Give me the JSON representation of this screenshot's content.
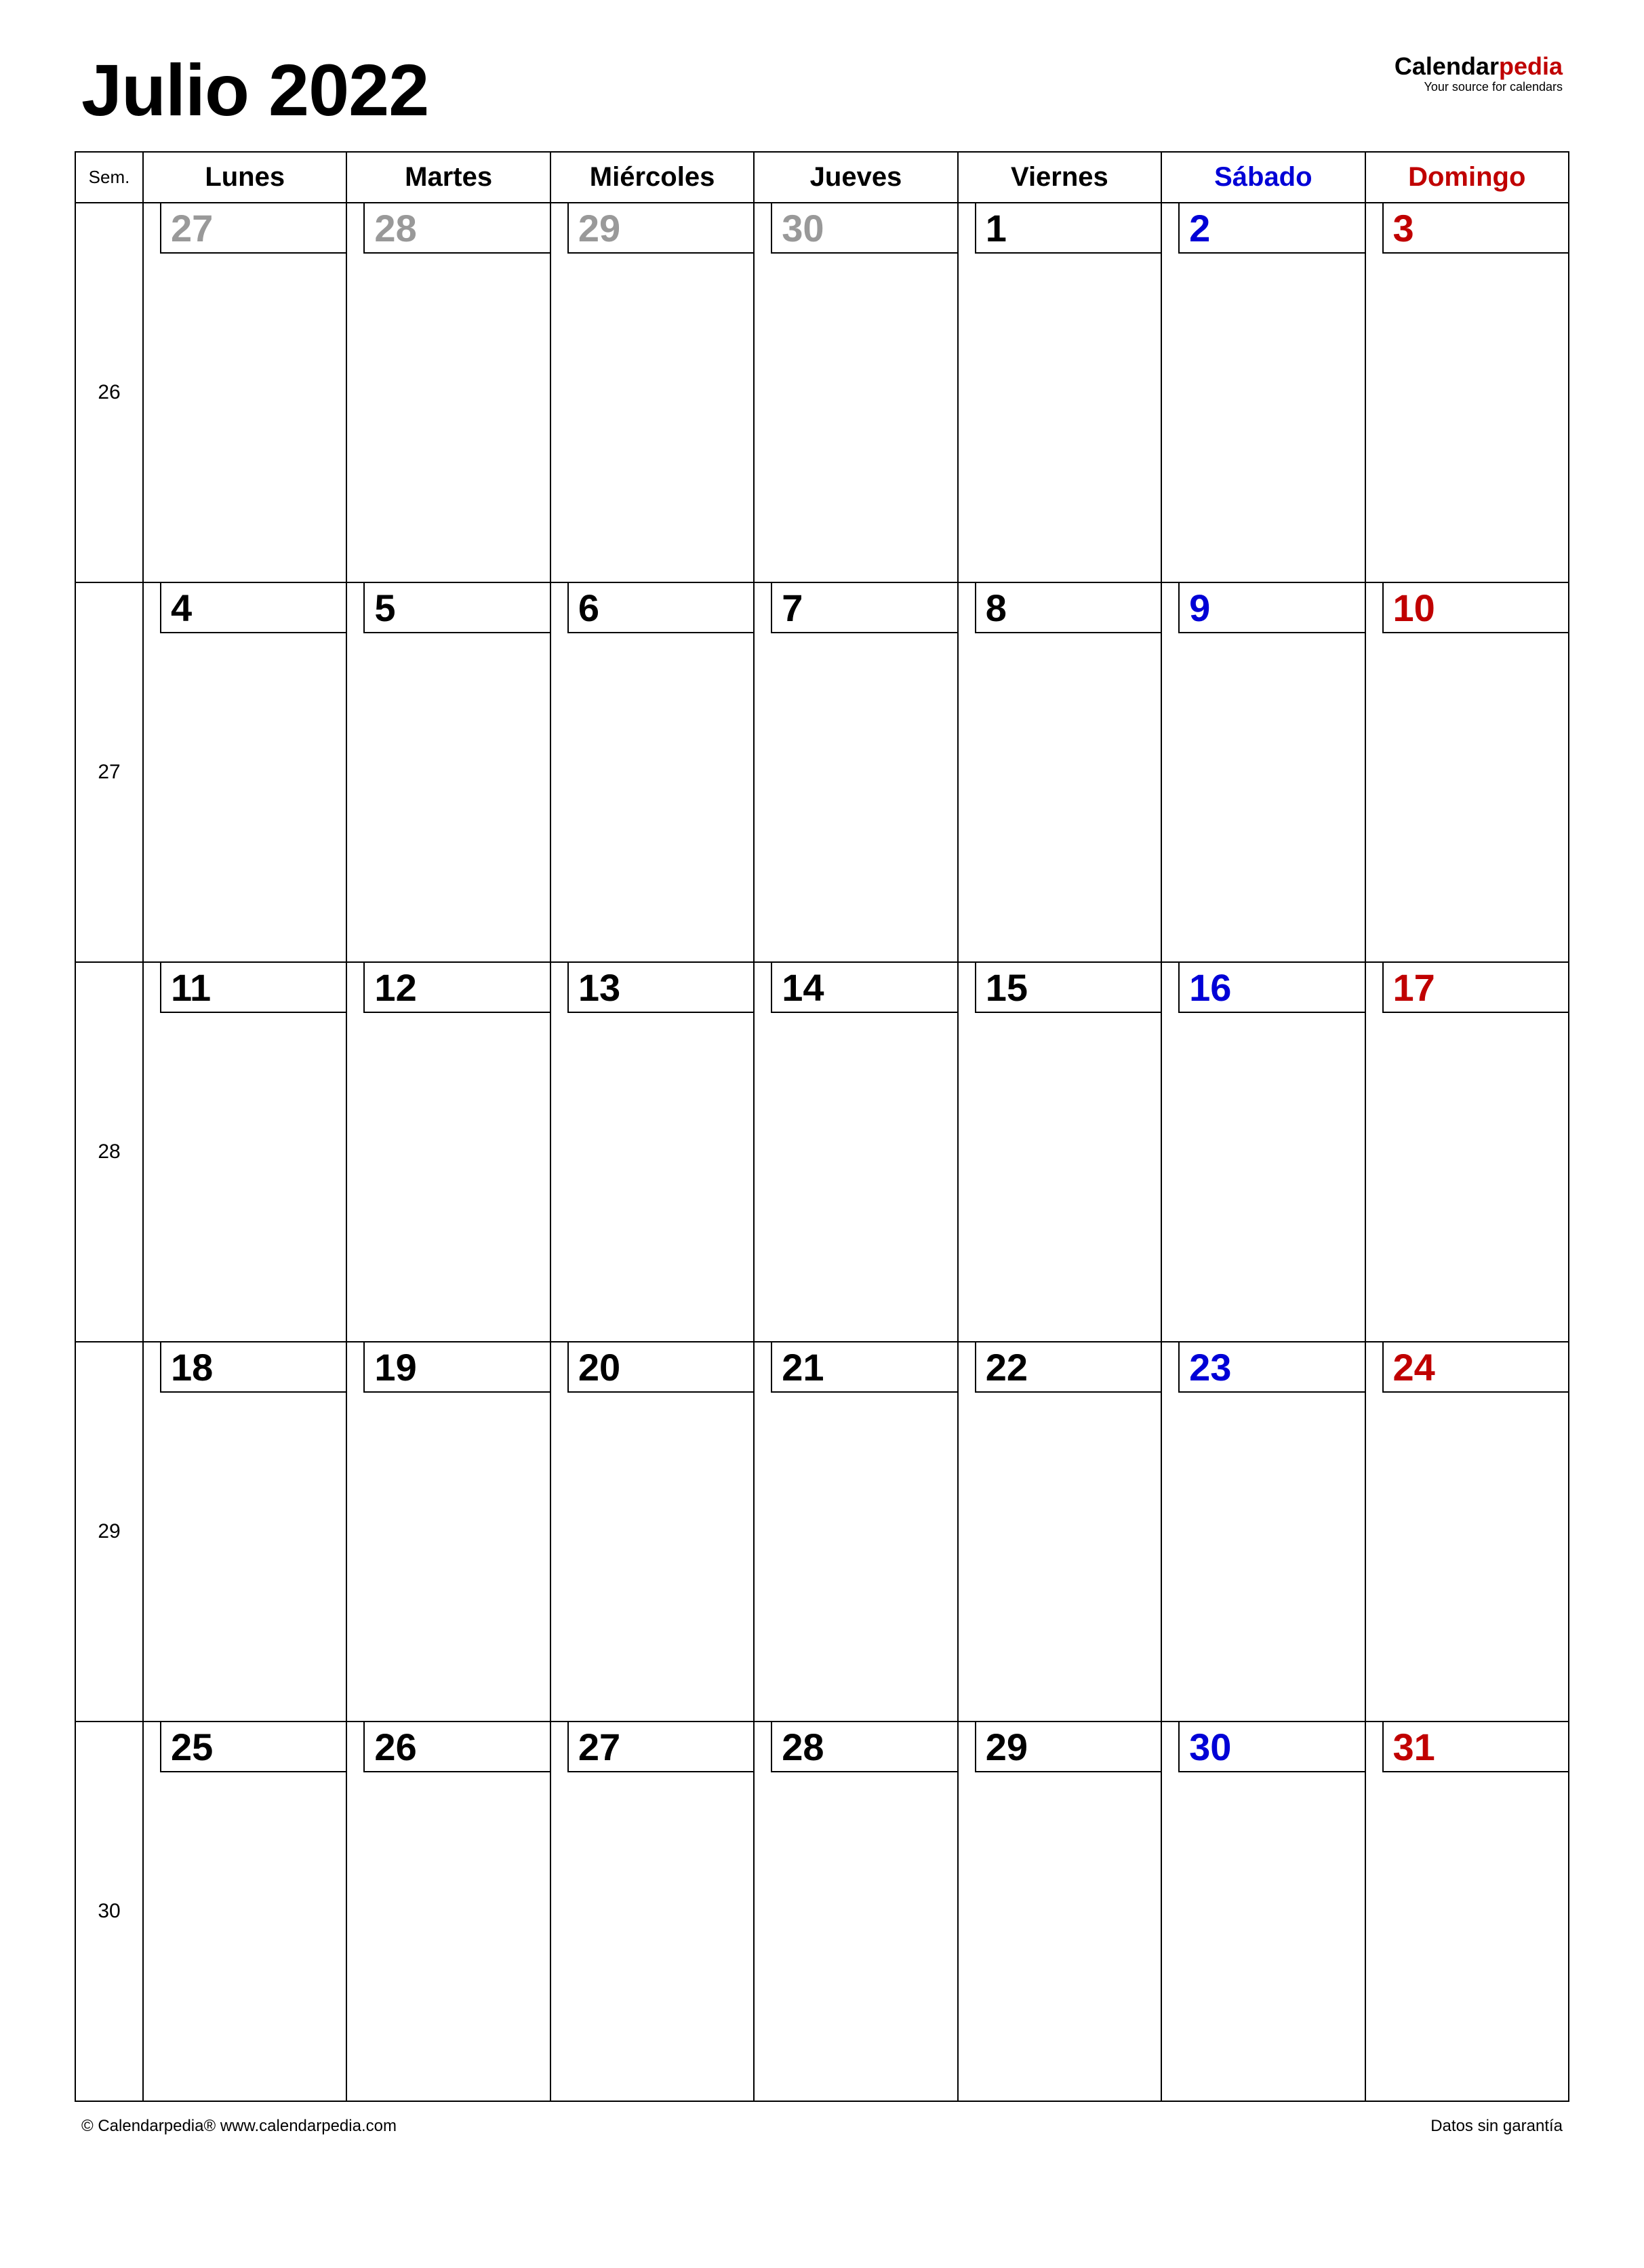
{
  "title": "Julio 2022",
  "logo": {
    "part1": "Calendar",
    "part2": "pedia",
    "tagline": "Your source for calendars"
  },
  "header": {
    "week_abbr": "Sem.",
    "days": [
      "Lunes",
      "Martes",
      "Miércoles",
      "Jueves",
      "Viernes",
      "Sábado",
      "Domingo"
    ]
  },
  "weeks": [
    {
      "num": "26",
      "days": [
        {
          "n": "27",
          "cls": "other"
        },
        {
          "n": "28",
          "cls": "other"
        },
        {
          "n": "29",
          "cls": "other"
        },
        {
          "n": "30",
          "cls": "other"
        },
        {
          "n": "1",
          "cls": ""
        },
        {
          "n": "2",
          "cls": "sat"
        },
        {
          "n": "3",
          "cls": "sun"
        }
      ]
    },
    {
      "num": "27",
      "days": [
        {
          "n": "4",
          "cls": ""
        },
        {
          "n": "5",
          "cls": ""
        },
        {
          "n": "6",
          "cls": ""
        },
        {
          "n": "7",
          "cls": ""
        },
        {
          "n": "8",
          "cls": ""
        },
        {
          "n": "9",
          "cls": "sat"
        },
        {
          "n": "10",
          "cls": "sun"
        }
      ]
    },
    {
      "num": "28",
      "days": [
        {
          "n": "11",
          "cls": ""
        },
        {
          "n": "12",
          "cls": ""
        },
        {
          "n": "13",
          "cls": ""
        },
        {
          "n": "14",
          "cls": ""
        },
        {
          "n": "15",
          "cls": ""
        },
        {
          "n": "16",
          "cls": "sat"
        },
        {
          "n": "17",
          "cls": "sun"
        }
      ]
    },
    {
      "num": "29",
      "days": [
        {
          "n": "18",
          "cls": ""
        },
        {
          "n": "19",
          "cls": ""
        },
        {
          "n": "20",
          "cls": ""
        },
        {
          "n": "21",
          "cls": ""
        },
        {
          "n": "22",
          "cls": ""
        },
        {
          "n": "23",
          "cls": "sat"
        },
        {
          "n": "24",
          "cls": "sun"
        }
      ]
    },
    {
      "num": "30",
      "days": [
        {
          "n": "25",
          "cls": ""
        },
        {
          "n": "26",
          "cls": ""
        },
        {
          "n": "27",
          "cls": ""
        },
        {
          "n": "28",
          "cls": ""
        },
        {
          "n": "29",
          "cls": ""
        },
        {
          "n": "30",
          "cls": "sat"
        },
        {
          "n": "31",
          "cls": "sun"
        }
      ]
    }
  ],
  "footer": {
    "left": "© Calendarpedia®   www.calendarpedia.com",
    "right": "Datos sin garantía"
  }
}
